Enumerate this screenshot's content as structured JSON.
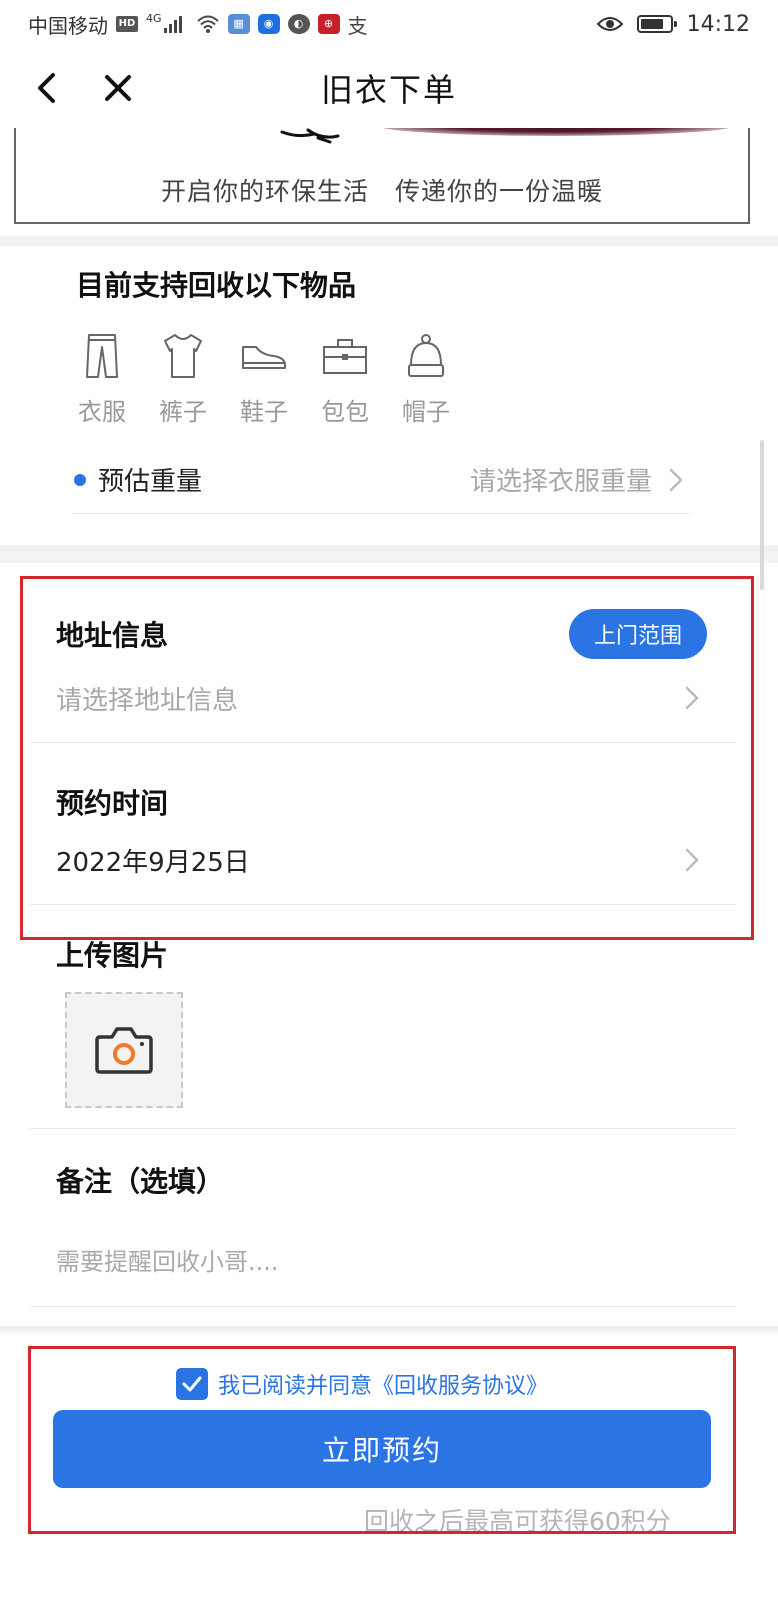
{
  "status_bar": {
    "carrier": "中国移动",
    "network": "4G",
    "time": "14:12",
    "alipay_glyph": "支"
  },
  "nav": {
    "title": "旧衣下单",
    "back_icon": "chevron-left-icon",
    "close_icon": "close-icon"
  },
  "banner": {
    "slogan": "开启你的环保生活　传递你的一份温暖"
  },
  "items": {
    "title": "目前支持回收以下物品",
    "list": [
      {
        "label": "衣服",
        "icon": "pants-icon"
      },
      {
        "label": "裤子",
        "icon": "shirt-icon"
      },
      {
        "label": "鞋子",
        "icon": "shoe-icon"
      },
      {
        "label": "包包",
        "icon": "bag-icon"
      },
      {
        "label": "帽子",
        "icon": "hat-icon"
      }
    ]
  },
  "weight": {
    "label": "预估重量",
    "placeholder": "请选择衣服重量"
  },
  "address": {
    "title": "地址信息",
    "range_button": "上门范围",
    "placeholder": "请选择地址信息"
  },
  "appointment": {
    "title": "预约时间",
    "value": "2022年9月25日"
  },
  "upload": {
    "title": "上传图片"
  },
  "note": {
    "title": "备注（选填）",
    "placeholder": "需要提醒回收小哥...."
  },
  "agreement": {
    "checked": true,
    "text": "我已阅读并同意《回收服务协议》"
  },
  "submit": {
    "label": "立即预约"
  },
  "bottom_note": "回收之后最高可获得60积分",
  "colors": {
    "accent": "#2b74e4",
    "highlight_border": "#d0282e",
    "placeholder": "#a8a8a8"
  }
}
